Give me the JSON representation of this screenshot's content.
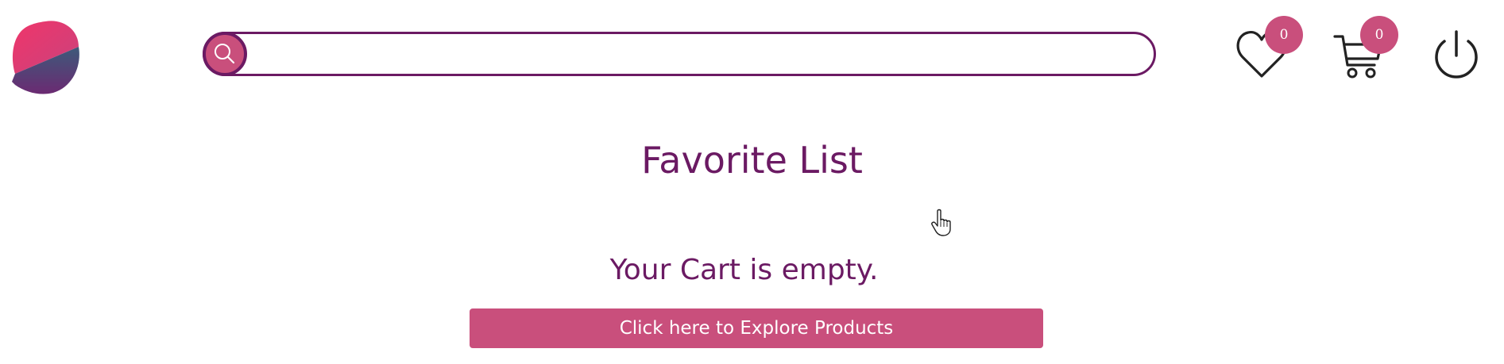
{
  "header": {
    "logo": {
      "icon": "brand-logo-icon"
    },
    "search": {
      "placeholder": "",
      "value": "",
      "icon": "search-icon"
    },
    "favorites": {
      "icon": "heart-icon",
      "count": "0"
    },
    "cart": {
      "icon": "cart-icon",
      "count": "0"
    },
    "power": {
      "icon": "power-icon"
    }
  },
  "main": {
    "title": "Favorite List",
    "empty_message": "Your Cart is empty.",
    "explore_button": "Click here to Explore Products"
  },
  "colors": {
    "primary": "#6b1a63",
    "accent": "#c94f7c",
    "logo_top": "#e63c6e",
    "logo_bottom": "#3b4a6b"
  }
}
